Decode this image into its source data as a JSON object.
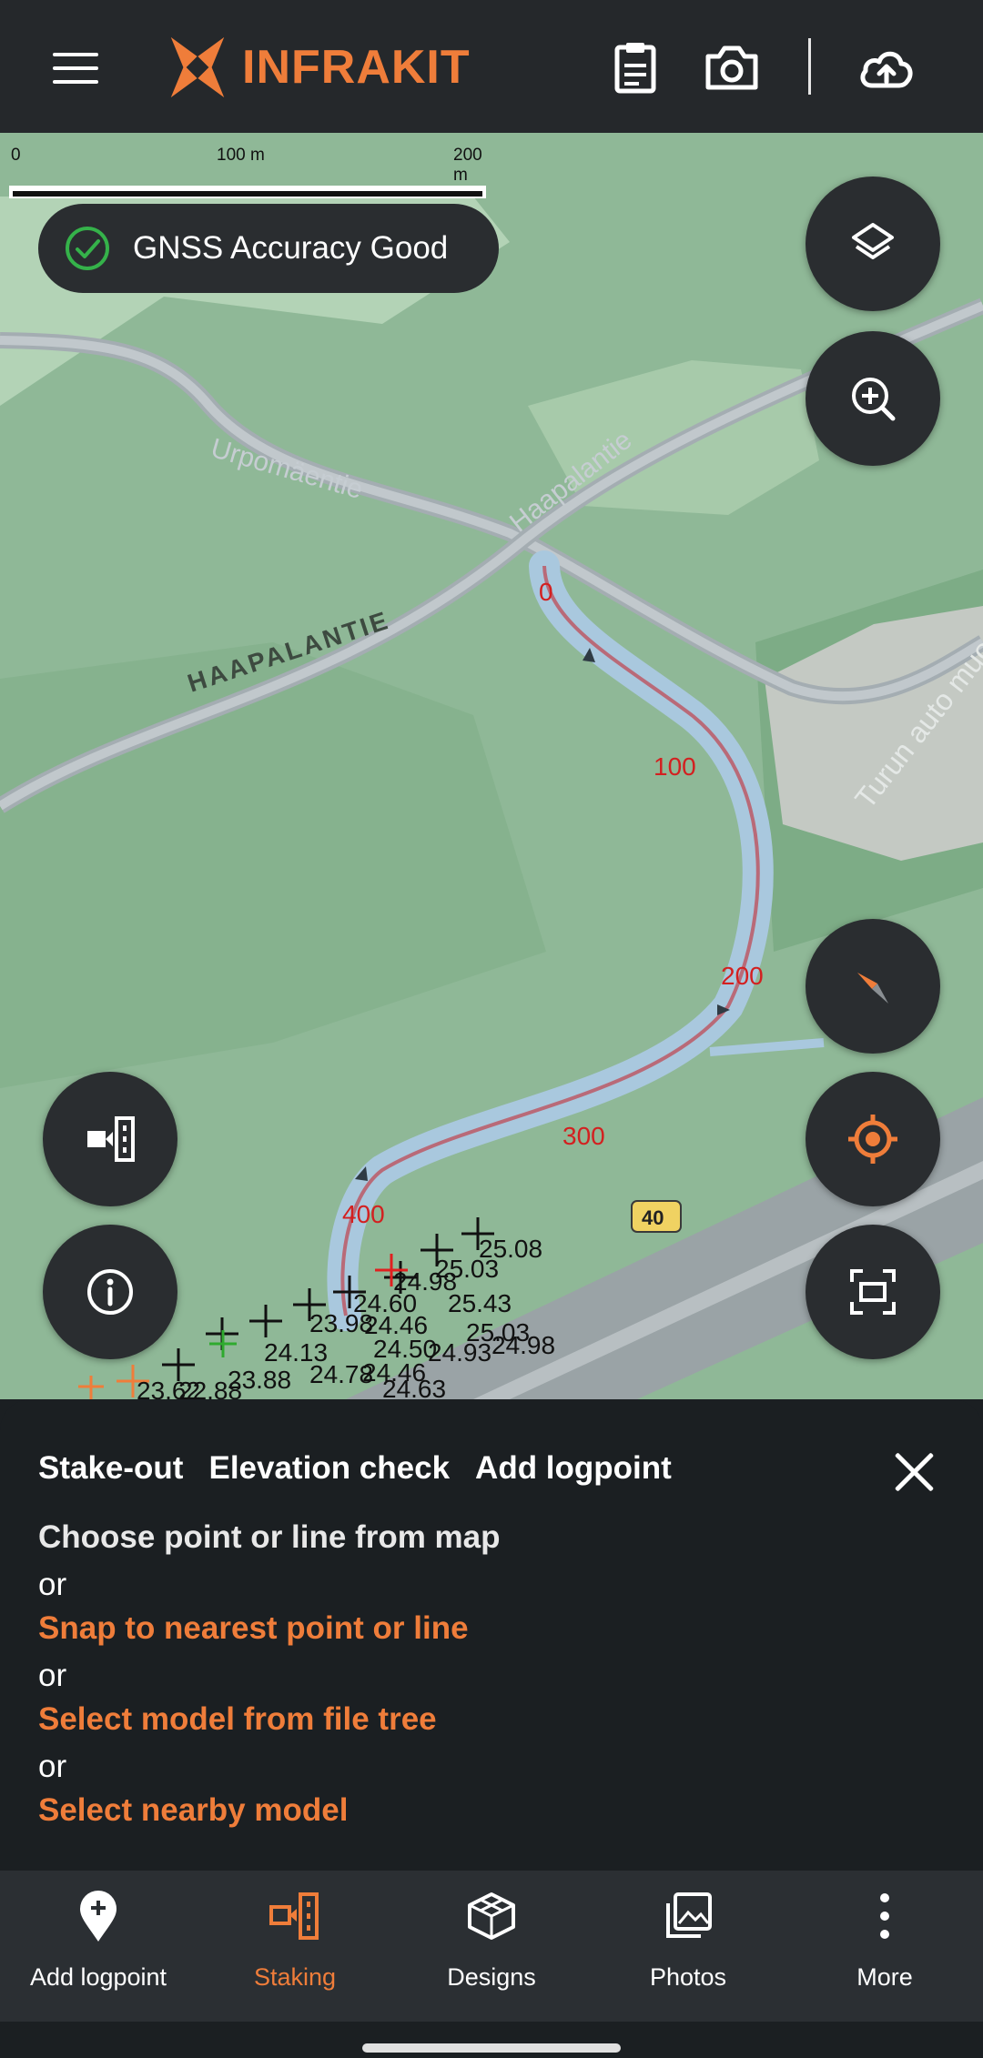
{
  "header": {
    "brand": "INFRAKIT",
    "icons": [
      "menu-icon",
      "clipboard-icon",
      "camera-icon",
      "cloud-upload-icon"
    ]
  },
  "map": {
    "scale": {
      "labels": [
        "0",
        "100 m",
        "200 m"
      ]
    },
    "gnss_status": "GNSS Accuracy Good",
    "road_labels": [
      "Urpomäentie",
      "Haapalantie",
      "HAAPALANTIE",
      "Turun auto muovike"
    ],
    "route_shield": "40",
    "station_labels": [
      "0",
      "100",
      "200",
      "300",
      "400"
    ],
    "elevation_labels": [
      "25.08",
      "25.03",
      "24.98",
      "25.43",
      "24.60",
      "25.03",
      "24.93",
      "24.98",
      "23.98",
      "24.46",
      "24.50",
      "24.46",
      "24.13",
      "24.78",
      "24.63",
      "23.88",
      "22.88",
      "23.62"
    ],
    "colors": {
      "map_green": "#8fb897",
      "road": "#9aa6ad",
      "water": "#a9c8de",
      "accent": "#ef7d3a"
    }
  },
  "sheet": {
    "tabs": [
      "Stake-out",
      "Elevation check",
      "Add logpoint"
    ],
    "instruction": "Choose point or line from map",
    "or1": "or",
    "option1": "Snap to nearest point or line",
    "or2": "or",
    "option2": "Select model from file tree",
    "or3": "or",
    "option3": "Select nearby model"
  },
  "nav": {
    "items": [
      {
        "label": "Add logpoint",
        "icon": "add-logpoint-icon"
      },
      {
        "label": "Staking",
        "icon": "staking-icon",
        "active": true
      },
      {
        "label": "Designs",
        "icon": "designs-icon"
      },
      {
        "label": "Photos",
        "icon": "photos-icon"
      },
      {
        "label": "More",
        "icon": "more-vertical-icon"
      }
    ]
  }
}
